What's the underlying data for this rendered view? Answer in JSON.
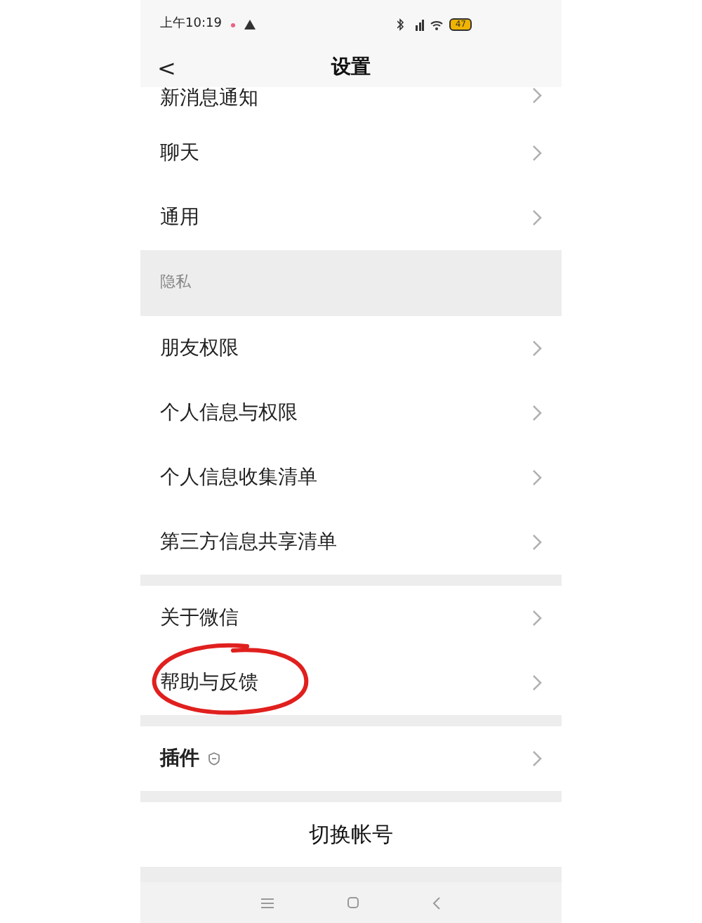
{
  "status_bar": {
    "time": "上午10:19",
    "battery": "47"
  },
  "header": {
    "back": "<",
    "title": "设置"
  },
  "groups": [
    {
      "items": [
        {
          "label": "新消息通知",
          "kind": "partial"
        },
        {
          "label": "聊天",
          "kind": "row"
        },
        {
          "label": "通用",
          "kind": "row"
        }
      ]
    },
    {
      "header": "隐私",
      "items": [
        {
          "label": "朋友权限",
          "kind": "row"
        },
        {
          "label": "个人信息与权限",
          "kind": "row"
        },
        {
          "label": "个人信息收集清单",
          "kind": "row"
        },
        {
          "label": "第三方信息共享清单",
          "kind": "row"
        }
      ]
    },
    {
      "items": [
        {
          "label": "关于微信",
          "kind": "row"
        },
        {
          "label": "帮助与反馈",
          "kind": "row",
          "circled": true
        }
      ]
    },
    {
      "items": [
        {
          "label": "插件",
          "kind": "plugin"
        }
      ]
    },
    {
      "items": [
        {
          "label": "切换帐号",
          "kind": "center"
        }
      ]
    }
  ]
}
